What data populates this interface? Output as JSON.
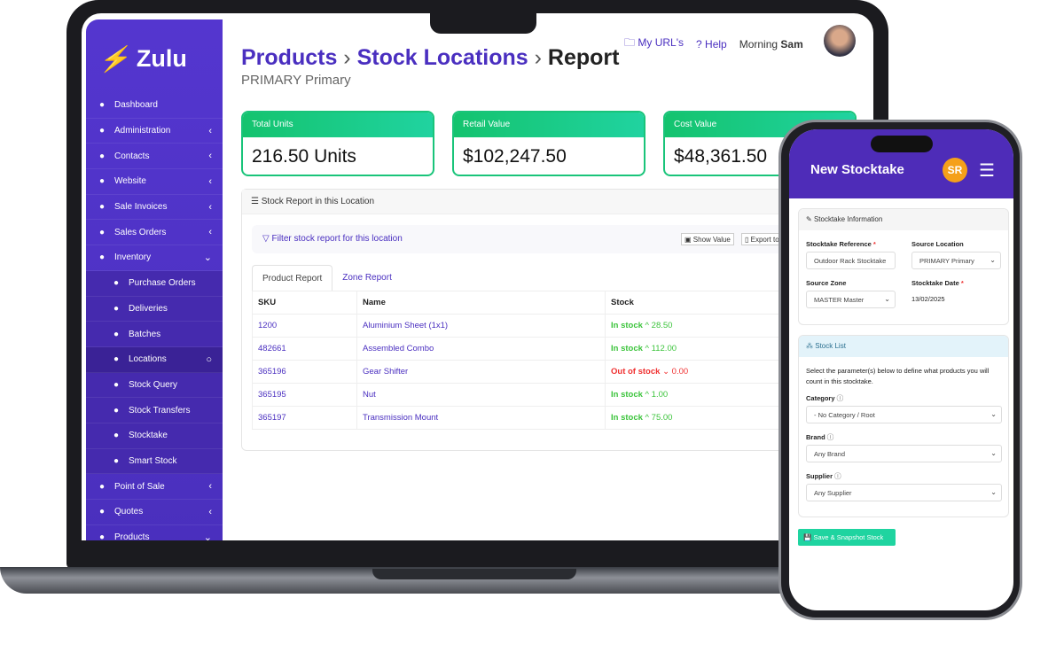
{
  "app": {
    "logo": "Zulu"
  },
  "sidebar": {
    "items": [
      {
        "label": "Dashboard",
        "icon": "gauge-icon",
        "chev": ""
      },
      {
        "label": "Administration",
        "icon": "admin-icon",
        "chev": "‹"
      },
      {
        "label": "Contacts",
        "icon": "users-icon",
        "chev": "‹"
      },
      {
        "label": "Website",
        "icon": "window-icon",
        "chev": "‹"
      },
      {
        "label": "Sale Invoices",
        "icon": "cash-icon",
        "chev": "‹"
      },
      {
        "label": "Sales Orders",
        "icon": "document-icon",
        "chev": "‹"
      },
      {
        "label": "Inventory",
        "icon": "truck-icon",
        "chev": "⌄"
      },
      {
        "label": "Purchase Orders",
        "icon": "tag-icon",
        "chev": ""
      },
      {
        "label": "Deliveries",
        "icon": "box-icon",
        "chev": ""
      },
      {
        "label": "Batches",
        "icon": "calendar-icon",
        "chev": ""
      },
      {
        "label": "Locations",
        "icon": "pin-icon",
        "chev": "○"
      },
      {
        "label": "Stock Query",
        "icon": "query-icon",
        "chev": ""
      },
      {
        "label": "Stock Transfers",
        "icon": "transfer-icon",
        "chev": ""
      },
      {
        "label": "Stocktake",
        "icon": "clipboard-icon",
        "chev": ""
      },
      {
        "label": "Smart Stock",
        "icon": "pencil-icon",
        "chev": ""
      },
      {
        "label": "Point of Sale",
        "icon": "pos-icon",
        "chev": "‹"
      },
      {
        "label": "Quotes",
        "icon": "quote-icon",
        "chev": "‹"
      },
      {
        "label": "Products",
        "icon": "cube-icon",
        "chev": "⌄"
      }
    ]
  },
  "header": {
    "crumbs": [
      "Products",
      "Stock Locations",
      "Report"
    ],
    "subtitle": "PRIMARY Primary",
    "my_urls": "My URL's",
    "help": "Help",
    "greeting": "Morning",
    "user": "Sam"
  },
  "cards": [
    {
      "label": "Total Units",
      "value": "216.50 Units"
    },
    {
      "label": "Retail Value",
      "value": "$102,247.50"
    },
    {
      "label": "Cost Value",
      "value": "$48,361.50"
    }
  ],
  "report": {
    "title": "Stock Report in this Location",
    "filter": "Filter stock report for this location",
    "show_value": "Show Value",
    "export": "Export to",
    "tabs": [
      "Product Report",
      "Zone Report"
    ],
    "columns": [
      "SKU",
      "Name",
      "Stock"
    ],
    "rows": [
      {
        "sku": "1200",
        "name": "Aluminium Sheet (1x1)",
        "status": "In stock",
        "qty": "28.50"
      },
      {
        "sku": "482661",
        "name": "Assembled Combo",
        "status": "In stock",
        "qty": "112.00"
      },
      {
        "sku": "365196",
        "name": "Gear Shifter",
        "status": "Out of stock",
        "qty": "0.00"
      },
      {
        "sku": "365195",
        "name": "Nut",
        "status": "In stock",
        "qty": "1.00"
      },
      {
        "sku": "365197",
        "name": "Transmission Mount",
        "status": "In stock",
        "qty": "75.00"
      }
    ]
  },
  "phone": {
    "title": "New Stocktake",
    "initials": "SR",
    "info_title": "Stocktake Information",
    "ref_label": "Stocktake Reference",
    "ref_value": "Outdoor Rack Stocktake",
    "loc_label": "Source Location",
    "loc_value": "PRIMARY Primary",
    "zone_label": "Source Zone",
    "zone_value": "MASTER Master",
    "date_label": "Stocktake Date",
    "date_value": "13/02/2025",
    "list_title": "Stock List",
    "list_desc": "Select the parameter(s) below to define what products you will count in this stocktake.",
    "category_label": "Category",
    "category_value": "- No Category / Root",
    "brand_label": "Brand",
    "brand_value": "Any Brand",
    "supplier_label": "Supplier",
    "supplier_value": "Any Supplier",
    "save": "Save & Snapshot Stock"
  },
  "colors": {
    "brand": "#4e2cb8",
    "green": "#19c47a",
    "in_stock": "#3cc43c",
    "out_stock": "#f03030",
    "avatar": "#f5a01a"
  }
}
